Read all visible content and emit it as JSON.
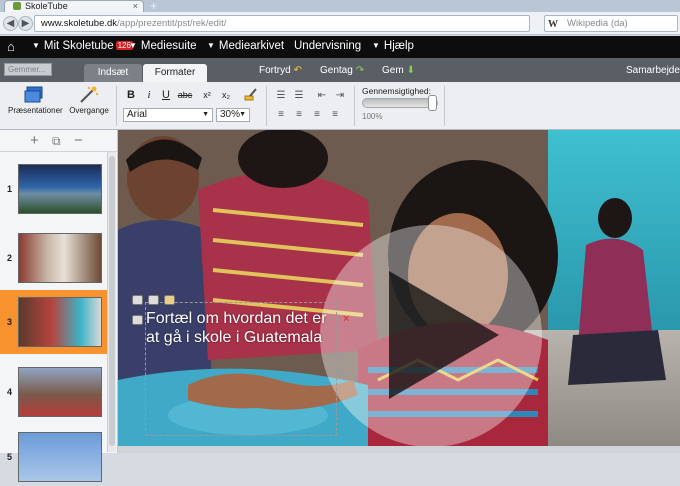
{
  "browser": {
    "tab_title": "SkoleTube",
    "tab_close": "×",
    "new_tab": "+",
    "back_icon": "◀",
    "forward_icon": "▶",
    "address_domain": "www.skoletube.dk",
    "address_path": "/app/prezentit/pst/rek/edit/",
    "star_icon": "☆",
    "search_engine_glyph": "W",
    "search_placeholder": "Wikipedia (da)"
  },
  "sitenav": {
    "home_icon": "⌂",
    "items": [
      {
        "label": "Mit Skoletube",
        "badge": "126",
        "caret": "▼"
      },
      {
        "label": "Mediesuite",
        "caret": "▼"
      },
      {
        "label": "Mediearkivet",
        "caret": "▼"
      },
      {
        "label": "Undervisning"
      },
      {
        "label": "Hjælp",
        "caret": "▼"
      }
    ]
  },
  "toolbar": {
    "search_placeholder": "Gemmer...",
    "tabs": [
      "Indsæt",
      "Formater"
    ],
    "active_tab": "Formater",
    "undo_label": "Fortryd",
    "redo_label": "Gentag",
    "save_label": "Gem",
    "collab_label": "Samarbejde",
    "undo_icon": "↶",
    "redo_icon": "↷",
    "save_icon": "⬇"
  },
  "ribbon": {
    "presentations_label": "Præsentationer",
    "transitions_label": "Overgange",
    "bold": "B",
    "italic": "i",
    "underline": "U",
    "strikethrough": "abc",
    "superscript": "x²",
    "subscript": "x₂",
    "font_family": "Arial",
    "font_size": "30%",
    "transparency_label": "Gennemsigtighed:",
    "transparency_value": "100%",
    "transparency_fraction": 1.0
  },
  "panel": {
    "add_icon": "+",
    "copy_icon": "⧉",
    "remove_icon": "−",
    "slides": [
      {
        "number": "1"
      },
      {
        "number": "2"
      },
      {
        "number": "3",
        "selected": true
      },
      {
        "number": "4"
      },
      {
        "number": "5"
      }
    ]
  },
  "slide": {
    "text": "Fortæl om hvordan det er at gå i skole i Guatemala",
    "close_icon": "×",
    "play_icon": "play"
  },
  "colors": {
    "nav_bg": "#0d0d0d",
    "selected_slide": "#f7922e",
    "badge": "#d42020"
  }
}
